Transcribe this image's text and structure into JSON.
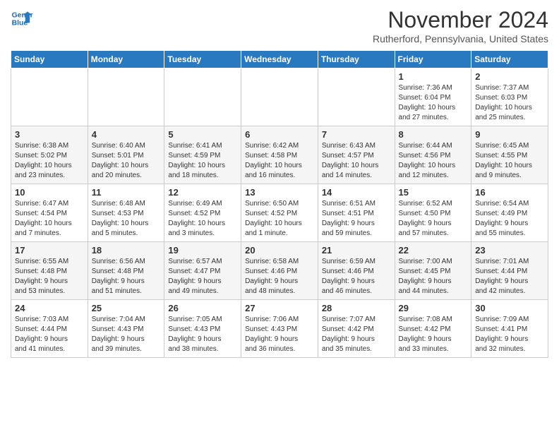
{
  "header": {
    "logo_line1": "General",
    "logo_line2": "Blue",
    "month": "November 2024",
    "location": "Rutherford, Pennsylvania, United States"
  },
  "days_of_week": [
    "Sunday",
    "Monday",
    "Tuesday",
    "Wednesday",
    "Thursday",
    "Friday",
    "Saturday"
  ],
  "weeks": [
    [
      {
        "day": "",
        "info": ""
      },
      {
        "day": "",
        "info": ""
      },
      {
        "day": "",
        "info": ""
      },
      {
        "day": "",
        "info": ""
      },
      {
        "day": "",
        "info": ""
      },
      {
        "day": "1",
        "info": "Sunrise: 7:36 AM\nSunset: 6:04 PM\nDaylight: 10 hours\nand 27 minutes."
      },
      {
        "day": "2",
        "info": "Sunrise: 7:37 AM\nSunset: 6:03 PM\nDaylight: 10 hours\nand 25 minutes."
      }
    ],
    [
      {
        "day": "3",
        "info": "Sunrise: 6:38 AM\nSunset: 5:02 PM\nDaylight: 10 hours\nand 23 minutes."
      },
      {
        "day": "4",
        "info": "Sunrise: 6:40 AM\nSunset: 5:01 PM\nDaylight: 10 hours\nand 20 minutes."
      },
      {
        "day": "5",
        "info": "Sunrise: 6:41 AM\nSunset: 4:59 PM\nDaylight: 10 hours\nand 18 minutes."
      },
      {
        "day": "6",
        "info": "Sunrise: 6:42 AM\nSunset: 4:58 PM\nDaylight: 10 hours\nand 16 minutes."
      },
      {
        "day": "7",
        "info": "Sunrise: 6:43 AM\nSunset: 4:57 PM\nDaylight: 10 hours\nand 14 minutes."
      },
      {
        "day": "8",
        "info": "Sunrise: 6:44 AM\nSunset: 4:56 PM\nDaylight: 10 hours\nand 12 minutes."
      },
      {
        "day": "9",
        "info": "Sunrise: 6:45 AM\nSunset: 4:55 PM\nDaylight: 10 hours\nand 9 minutes."
      }
    ],
    [
      {
        "day": "10",
        "info": "Sunrise: 6:47 AM\nSunset: 4:54 PM\nDaylight: 10 hours\nand 7 minutes."
      },
      {
        "day": "11",
        "info": "Sunrise: 6:48 AM\nSunset: 4:53 PM\nDaylight: 10 hours\nand 5 minutes."
      },
      {
        "day": "12",
        "info": "Sunrise: 6:49 AM\nSunset: 4:52 PM\nDaylight: 10 hours\nand 3 minutes."
      },
      {
        "day": "13",
        "info": "Sunrise: 6:50 AM\nSunset: 4:52 PM\nDaylight: 10 hours\nand 1 minute."
      },
      {
        "day": "14",
        "info": "Sunrise: 6:51 AM\nSunset: 4:51 PM\nDaylight: 9 hours\nand 59 minutes."
      },
      {
        "day": "15",
        "info": "Sunrise: 6:52 AM\nSunset: 4:50 PM\nDaylight: 9 hours\nand 57 minutes."
      },
      {
        "day": "16",
        "info": "Sunrise: 6:54 AM\nSunset: 4:49 PM\nDaylight: 9 hours\nand 55 minutes."
      }
    ],
    [
      {
        "day": "17",
        "info": "Sunrise: 6:55 AM\nSunset: 4:48 PM\nDaylight: 9 hours\nand 53 minutes."
      },
      {
        "day": "18",
        "info": "Sunrise: 6:56 AM\nSunset: 4:48 PM\nDaylight: 9 hours\nand 51 minutes."
      },
      {
        "day": "19",
        "info": "Sunrise: 6:57 AM\nSunset: 4:47 PM\nDaylight: 9 hours\nand 49 minutes."
      },
      {
        "day": "20",
        "info": "Sunrise: 6:58 AM\nSunset: 4:46 PM\nDaylight: 9 hours\nand 48 minutes."
      },
      {
        "day": "21",
        "info": "Sunrise: 6:59 AM\nSunset: 4:46 PM\nDaylight: 9 hours\nand 46 minutes."
      },
      {
        "day": "22",
        "info": "Sunrise: 7:00 AM\nSunset: 4:45 PM\nDaylight: 9 hours\nand 44 minutes."
      },
      {
        "day": "23",
        "info": "Sunrise: 7:01 AM\nSunset: 4:44 PM\nDaylight: 9 hours\nand 42 minutes."
      }
    ],
    [
      {
        "day": "24",
        "info": "Sunrise: 7:03 AM\nSunset: 4:44 PM\nDaylight: 9 hours\nand 41 minutes."
      },
      {
        "day": "25",
        "info": "Sunrise: 7:04 AM\nSunset: 4:43 PM\nDaylight: 9 hours\nand 39 minutes."
      },
      {
        "day": "26",
        "info": "Sunrise: 7:05 AM\nSunset: 4:43 PM\nDaylight: 9 hours\nand 38 minutes."
      },
      {
        "day": "27",
        "info": "Sunrise: 7:06 AM\nSunset: 4:43 PM\nDaylight: 9 hours\nand 36 minutes."
      },
      {
        "day": "28",
        "info": "Sunrise: 7:07 AM\nSunset: 4:42 PM\nDaylight: 9 hours\nand 35 minutes."
      },
      {
        "day": "29",
        "info": "Sunrise: 7:08 AM\nSunset: 4:42 PM\nDaylight: 9 hours\nand 33 minutes."
      },
      {
        "day": "30",
        "info": "Sunrise: 7:09 AM\nSunset: 4:41 PM\nDaylight: 9 hours\nand 32 minutes."
      }
    ]
  ]
}
